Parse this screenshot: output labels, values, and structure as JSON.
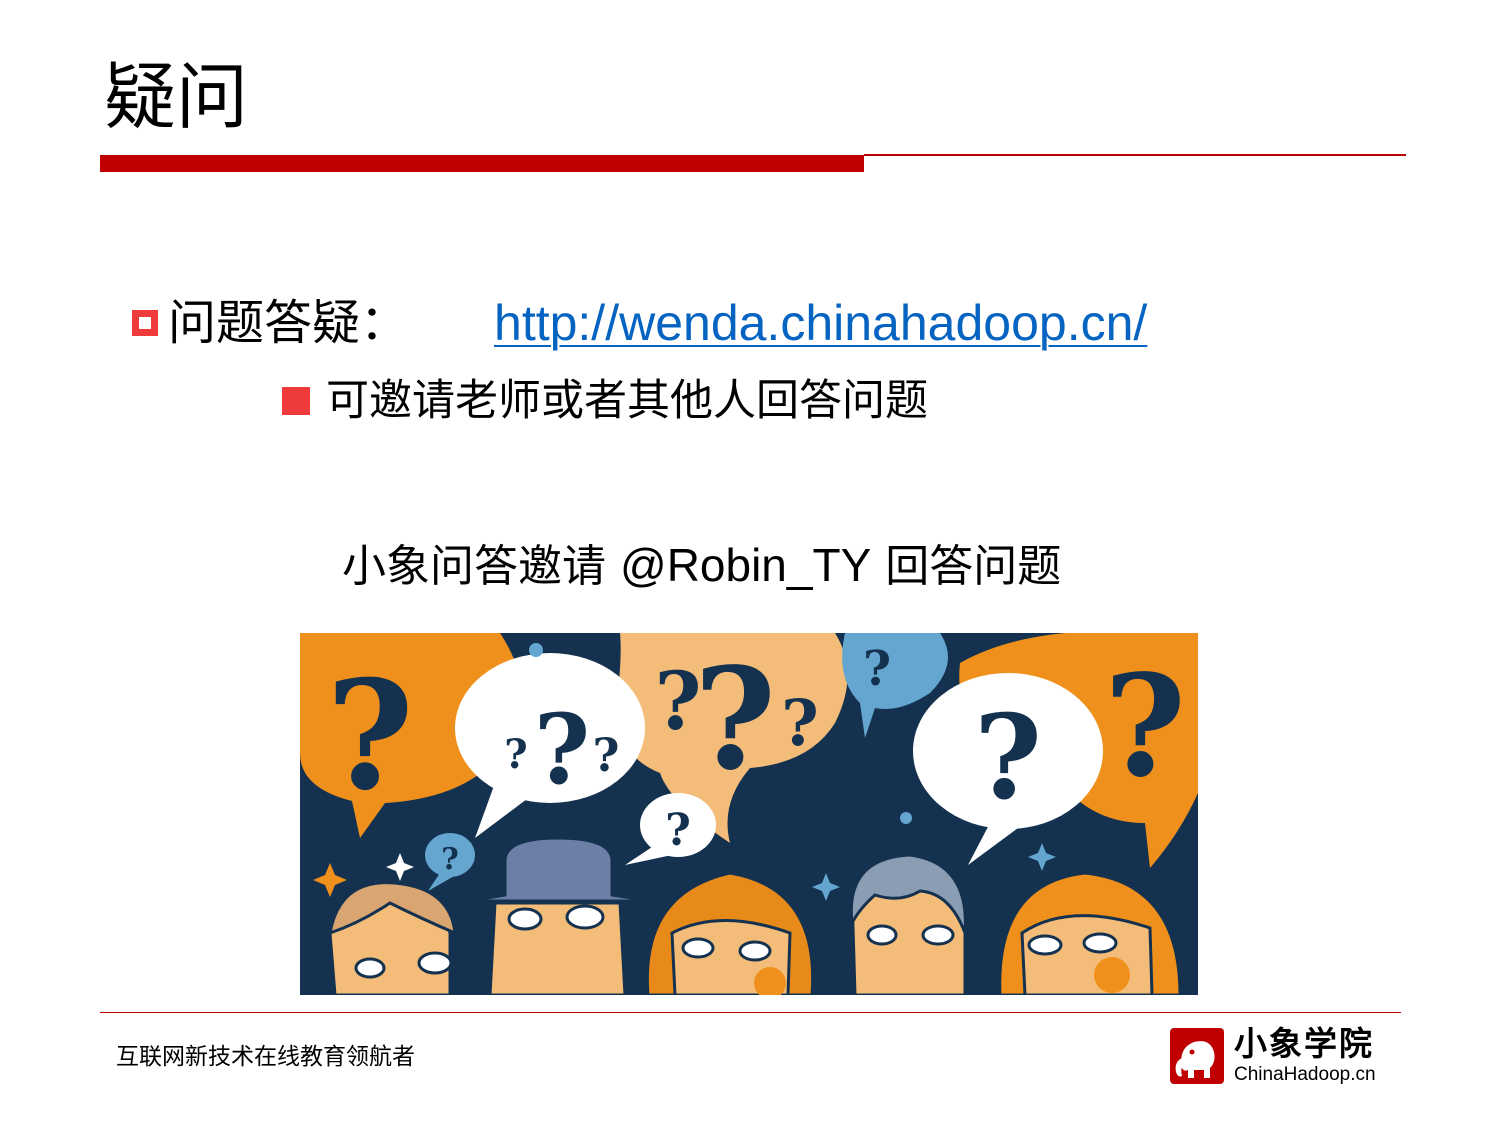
{
  "slide": {
    "title": "疑问"
  },
  "colors": {
    "accent_red": "#c00000",
    "bullet_red": "#ef3b3b",
    "link_blue": "#0563c1",
    "text": "#000000",
    "illustration_navy": "#14324f",
    "illustration_orange": "#f0901c",
    "illustration_peach": "#f3bc78",
    "illustration_light_blue": "#64a6cf"
  },
  "content": {
    "bullet_label": "问题答疑：",
    "bullet_link": "http://wenda.chinahadoop.cn/",
    "sub_bullet": "可邀请老师或者其他人回答问题",
    "invite_prefix": "小象问答邀请",
    "invite_user": "@Robin_TY",
    "invite_suffix": "回答问题"
  },
  "illustration": {
    "subject": "cartoon faces with question-mark speech bubbles",
    "question_mark": "?"
  },
  "footer": {
    "slogan": "互联网新技术在线教育领航者",
    "logo_name": "小象学院",
    "logo_domain": "ChinaHadoop.cn",
    "logo_icon": "elephant-icon"
  }
}
